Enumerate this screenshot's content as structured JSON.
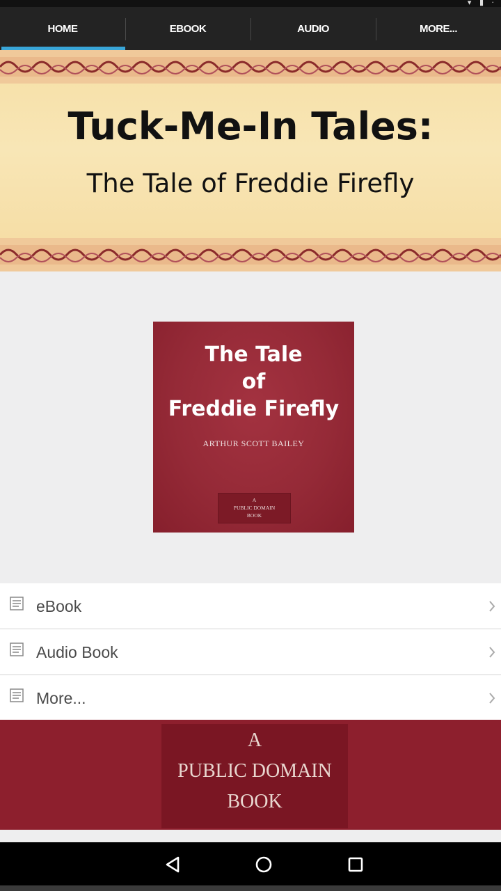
{
  "tabs": [
    {
      "label": "HOME",
      "active": true
    },
    {
      "label": "EBOOK",
      "active": false
    },
    {
      "label": "AUDIO",
      "active": false
    },
    {
      "label": "MORE...",
      "active": false
    }
  ],
  "banner": {
    "title": "Tuck-Me-In Tales:",
    "subtitle": "The Tale of Freddie Firefly"
  },
  "cover": {
    "title_lines": [
      "The Tale",
      "of",
      "Freddie Firefly"
    ],
    "author": "ARTHUR SCOTT BAILEY",
    "badge_lines": [
      "A",
      "PUBLIC DOMAIN",
      "BOOK"
    ]
  },
  "menu": [
    {
      "label": "eBook",
      "icon": "document-icon"
    },
    {
      "label": "Audio Book",
      "icon": "document-icon"
    },
    {
      "label": "More...",
      "icon": "document-icon"
    }
  ],
  "footer_banner": {
    "lines": [
      "A",
      "PUBLIC DOMAIN",
      "BOOK"
    ]
  },
  "colors": {
    "tab_bar": "#232323",
    "tab_indicator": "#39a6d8",
    "banner_bg": "#f6dfa5",
    "cover_red": "#952a37",
    "list_text": "#4a4a4a"
  },
  "nav": {
    "back_icon": "back-triangle-icon",
    "home_icon": "home-circle-icon",
    "recents_icon": "recents-square-icon"
  }
}
